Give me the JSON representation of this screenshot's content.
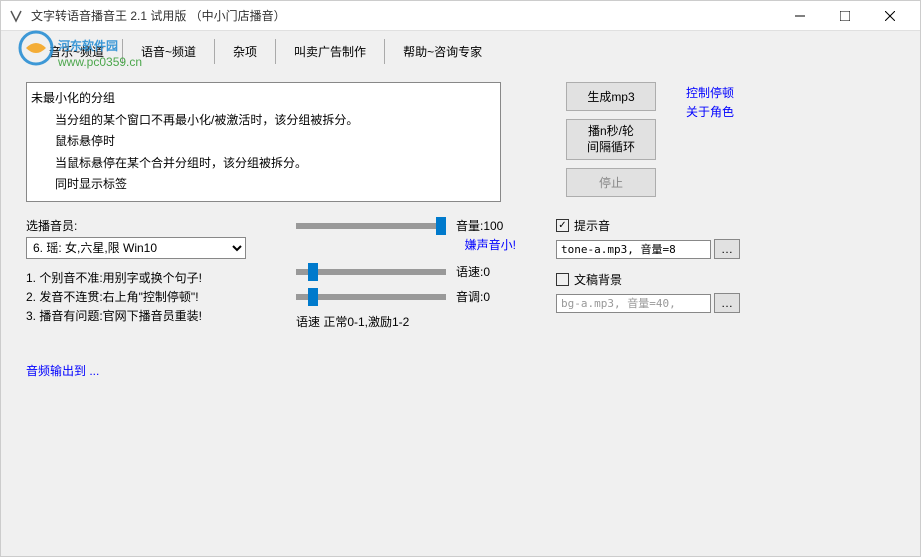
{
  "title": "文字转语音播音王 2.1 试用版 （中小门店播音）",
  "watermark_text1": "河东软件园",
  "watermark_text2": "www.pc0359.cn",
  "menu": [
    "音乐~频道",
    "语音~频道",
    "杂项",
    "叫卖广告制作",
    "帮助~咨询专家"
  ],
  "textbox_lines": [
    {
      "text": "未最小化的分组",
      "indent": false
    },
    {
      "text": "当分组的某个窗口不再最小化/被激活时，该分组被拆分。",
      "indent": true
    },
    {
      "text": "鼠标悬停时",
      "indent": true
    },
    {
      "text": "当鼠标悬停在某个合并分组时，该分组被拆分。",
      "indent": true
    },
    {
      "text": "同时显示标签",
      "indent": true
    }
  ],
  "buttons": {
    "generate": "生成mp3",
    "loop": "播n秒/轮\n间隔循环",
    "stop": "停止"
  },
  "links": {
    "pause": "控制停顿",
    "about": "关于角色"
  },
  "announcer_label": "选播音员:",
  "announcer_value": "6. 瑶: 女,六星,限 Win10",
  "tips": [
    "1. 个别音不准:用别字或换个句子!",
    "2. 发音不连贯:右上角\"控制停顿\"!",
    "3. 播音有问题:官网下播音员重装!"
  ],
  "volume_label": "音量:100",
  "soft_hint": "嫌声音小!",
  "speed_label": "语速:0",
  "pitch_label": "音调:0",
  "speed_range": "语速  正常0-1,激励1-2",
  "tone_check": "提示音",
  "tone_value": "tone-a.mp3, 音量=8",
  "bg_check": "文稿背景",
  "bg_value": "bg-a.mp3, 音量=40,",
  "audio_out": "音频输出到 ..."
}
